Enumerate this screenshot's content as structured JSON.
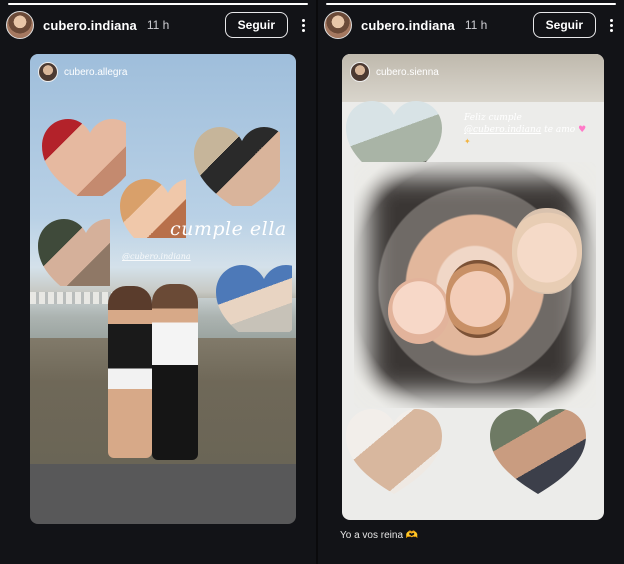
{
  "left_story": {
    "username": "cubero.indiana",
    "time": "11 h",
    "follow_label": "Seguir",
    "progress_fraction": 1.0,
    "repost": {
      "username": "cubero.allegra",
      "caption": "cumple ella",
      "mention": "@cubero.indiana"
    }
  },
  "right_story": {
    "username": "cubero.indiana",
    "time": "11 h",
    "follow_label": "Seguir",
    "progress_fraction": 1.0,
    "repost": {
      "username": "cubero.sienna",
      "caption_line1": "Feliz cumple",
      "caption_mention": "@cubero.indiana",
      "caption_line2": "te amo",
      "heart_emoji": "♥",
      "sparkle": "✦"
    },
    "bottom_caption": "Yo a vos reina 🫶"
  },
  "icons": {
    "more": "more-vertical-icon",
    "heart": "heart-emoji-icon"
  },
  "colors": {
    "background": "#121317",
    "accent_pink": "#ff7ac8"
  }
}
